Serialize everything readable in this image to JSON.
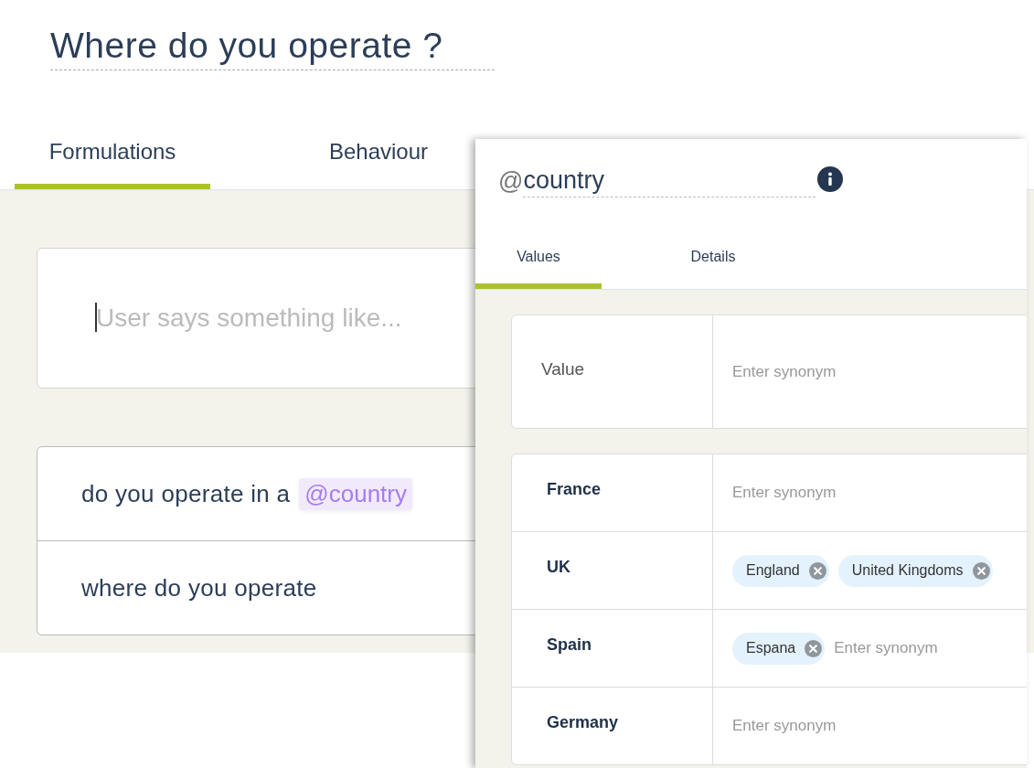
{
  "intent": {
    "title": "Where do you operate ?"
  },
  "tabs": [
    {
      "label": "Formulations",
      "selected": true
    },
    {
      "label": "Behaviour",
      "selected": false
    }
  ],
  "utterance_input": {
    "placeholder": "User says something like..."
  },
  "formulations": [
    {
      "parts": [
        {
          "kind": "plain",
          "text": "do you operate in a"
        },
        {
          "kind": "entity",
          "text": "@country"
        }
      ]
    },
    {
      "parts": [
        {
          "kind": "plain",
          "text": "where do you operate"
        }
      ]
    }
  ],
  "entity_panel": {
    "prefix": "@",
    "name": "country",
    "tabs": [
      {
        "label": "Values",
        "selected": true
      },
      {
        "label": "Details",
        "selected": false
      }
    ],
    "header": {
      "label": "Value",
      "placeholder": "Enter synonym"
    },
    "values": [
      {
        "name": "France",
        "placeholder": "Enter synonym"
      },
      {
        "name": "UK",
        "synonyms": [
          "England",
          "United Kingdoms"
        ]
      },
      {
        "name": "Spain",
        "synonyms": [
          "Espana"
        ],
        "placeholder": "Enter synonym"
      },
      {
        "name": "Germany",
        "placeholder": "Enter synonym"
      }
    ]
  }
}
